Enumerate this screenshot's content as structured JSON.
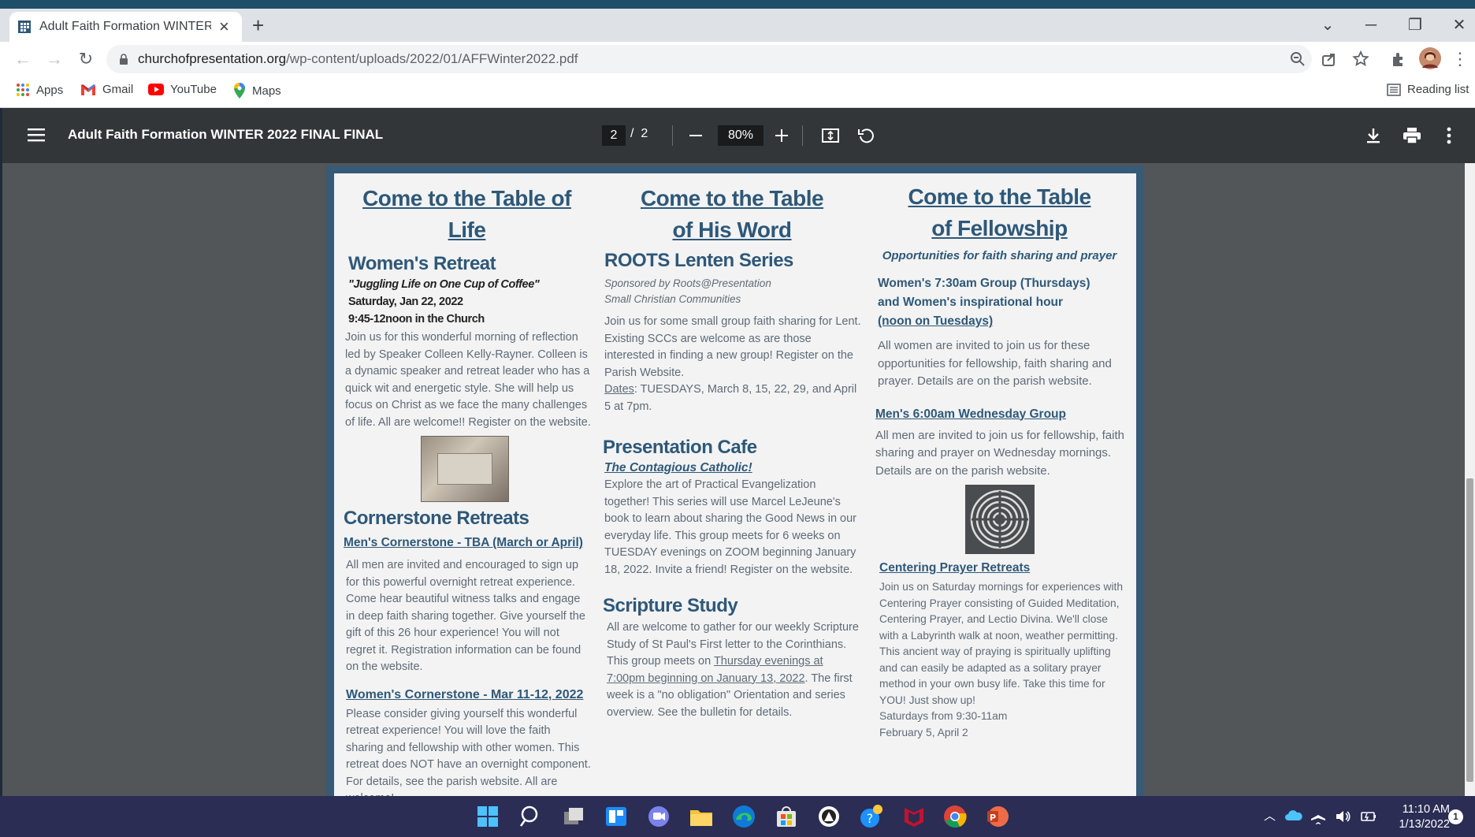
{
  "browser": {
    "tab_title": "Adult Faith Formation WINTER 2022 FINAL FINAL",
    "url_host": "churchofpresentation.org",
    "url_path": "/wp-content/uploads/2022/01/AFFWinter2022.pdf",
    "bookmarks": [
      "Apps",
      "Gmail",
      "YouTube",
      "Maps"
    ],
    "reading_list": "Reading list"
  },
  "pdf": {
    "title": "Adult Faith Formation WINTER 2022 FINAL FINAL",
    "current_page": "2",
    "page_sep": "/",
    "total_pages": "2",
    "zoom": "80%"
  },
  "col1": {
    "heading": "Come to the Table of Life",
    "retreat_title": "Women's Retreat",
    "retreat_quote": "\"Juggling Life on One Cup of Coffee\"",
    "retreat_date": "Saturday, Jan 22, 2022",
    "retreat_time": "9:45-12noon in the Church",
    "retreat_body": "Join us for this wonderful morning of reflection led by Speaker Colleen Kelly-Rayner. Colleen is a dynamic speaker and retreat leader who has a quick wit and energetic style. She will help us focus on Christ as we face the many challenges of life. All are welcome!! Register on the website.",
    "cornerstone_title": "Cornerstone Retreats",
    "mens_link": "Men's Cornerstone - TBA (March or April)",
    "mens_body": "All men are invited and encouraged to sign up for this powerful overnight retreat experience. Come hear beautiful witness talks and engage in deep faith sharing together. Give yourself the gift of this 26 hour experience! You will not regret it. Registration information can be found on the website.",
    "womens_link": "Women's Cornerstone - Mar 11-12, 2022",
    "womens_body": "Please consider giving yourself this wonderful retreat experience! You will love the faith sharing and fellowship with other women. This retreat does NOT have an overnight component. For details, see the parish website. All are welcome!"
  },
  "col2": {
    "heading_1": "Come to the Table",
    "heading_2": "of His Word",
    "roots_title": "ROOTS Lenten Series",
    "roots_sponsor_1": "Sponsored by Roots@Presentation",
    "roots_sponsor_2": "Small Christian Communities",
    "roots_body": "Join us for some small group faith sharing for Lent. Existing SCCs are welcome as are those interested in finding a new group! Register on the Parish Website.",
    "roots_dates_label": "Dates",
    "roots_dates": ": TUESDAYS, March 8, 15, 22, 29, and April 5 at 7pm.",
    "cafe_title": "Presentation Cafe",
    "cafe_sub": "The Contagious Catholic!",
    "cafe_body": "Explore the art of Practical Evangelization together! This series will use Marcel LeJeune's book to learn about sharing the Good News in our everyday life. This group meets for 6 weeks on TUESDAY evenings on ZOOM beginning January 18, 2022. Invite a friend! Register on the website.",
    "scripture_title": "Scripture Study",
    "scripture_body_1": "All are welcome to gather for our weekly Scripture Study of St Paul's First letter to the Corinthians. This group meets on ",
    "scripture_link": "Thursday evenings at 7:00pm beginning on January 13, 2022",
    "scripture_body_2": ". The first week is a \"no obligation\" Orientation and series overview. See the bulletin for details."
  },
  "col3": {
    "heading_1": "Come to the Table",
    "heading_2": "of Fellowship",
    "tagline": "Opportunities for faith sharing and prayer",
    "womens_group_1": "Women's 7:30am Group (Thursdays)",
    "womens_group_2": "and Women's inspirational hour",
    "womens_group_3": "(noon on Tuesdays)",
    "womens_body": "All women are invited to join us for these opportunities for fellowship, faith sharing and prayer. Details are on the parish website.",
    "mens_group": "Men's 6:00am Wednesday Group",
    "mens_body": "All men are invited to join us for fellowship, faith sharing and prayer on Wednesday mornings. Details are on the parish website.",
    "centering_title": "Centering Prayer Retreats",
    "centering_body": "Join us on Saturday mornings for experiences with Centering Prayer consisting of Guided Meditation, Centering Prayer, and Lectio Divina. We'll close with a Labyrinth walk at noon, weather permitting. This ancient way of praying is spiritually uplifting and can easily be adapted as a solitary prayer method in your own busy life. Take this time for YOU! Just show up!",
    "centering_time": "Saturdays from 9:30-11am",
    "centering_dates": "February 5, April 2"
  },
  "taskbar": {
    "time": "11:10 AM",
    "date": "1/13/2022",
    "notif_count": "1"
  },
  "colors": {
    "heading_blue": "#2e5879",
    "page_border": "#375a76",
    "taskbar": "#2b2d55"
  }
}
